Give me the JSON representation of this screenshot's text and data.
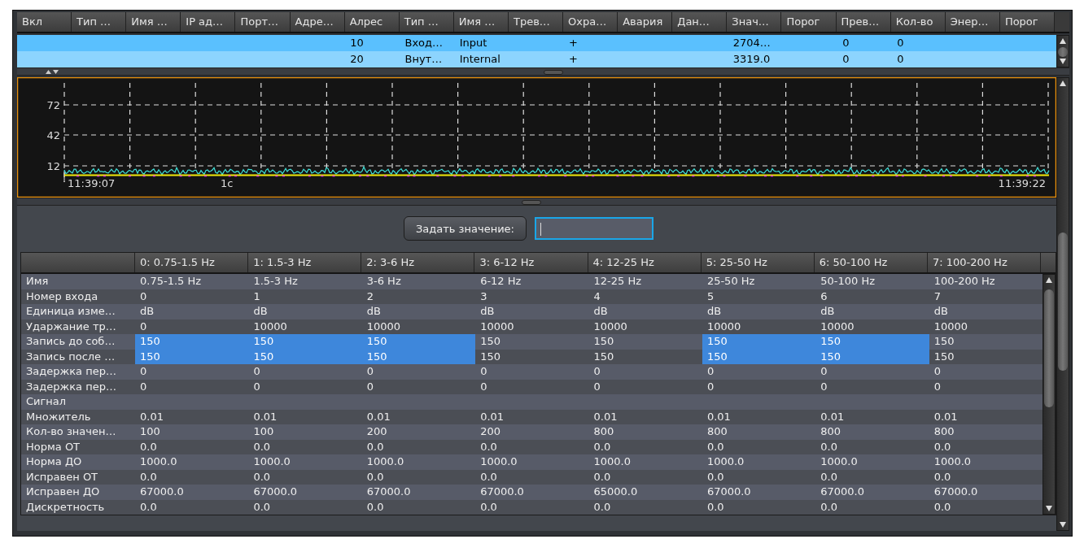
{
  "top_table": {
    "columns": [
      "Вкл",
      "Тип …",
      "Имя …",
      "IP ад…",
      "Порт…",
      "Адре…",
      "Алрес",
      "Тип …",
      "Имя …",
      "Трев…",
      "Охра…",
      "Авария",
      "Дан…",
      "Знач…",
      "Порог",
      "Прев…",
      "Кол-во",
      "Энер…",
      "Порог"
    ],
    "rows": [
      {
        "selected": true,
        "cells": [
          null,
          null,
          null,
          null,
          null,
          null,
          "10",
          "Вход…",
          "Input",
          null,
          "+",
          null,
          null,
          "2704…",
          null,
          "0",
          "0",
          null,
          null
        ]
      },
      {
        "selected": true,
        "cells": [
          null,
          null,
          null,
          null,
          null,
          null,
          "20",
          "Внут…",
          "Internal",
          null,
          "+",
          null,
          null,
          "3319.0",
          null,
          "0",
          "0",
          null,
          null
        ]
      }
    ]
  },
  "chart": {
    "y_ticks": [
      "72",
      "42",
      "12"
    ],
    "time_start": "11:39:07",
    "scale_label": "1c",
    "time_end": "11:39:22"
  },
  "set_value_button": "Задать значение:",
  "value_input": {
    "focused": true
  },
  "parameters": {
    "columns": [
      "0: 0.75-1.5 Hz",
      "1: 1.5-3 Hz",
      "2: 3-6 Hz",
      "3: 6-12 Hz",
      "4: 12-25 Hz",
      "5: 25-50 Hz",
      "6: 50-100 Hz",
      "7: 100-200 Hz"
    ],
    "rows": [
      {
        "label": "Имя",
        "cells": [
          {
            "text": "0.75-1.5 Hz",
            "selected": false
          },
          {
            "text": "1.5-3 Hz",
            "selected": false
          },
          {
            "text": "3-6 Hz",
            "selected": false
          },
          {
            "text": "6-12 Hz",
            "selected": false
          },
          {
            "text": "12-25 Hz",
            "selected": false
          },
          {
            "text": "25-50 Hz",
            "selected": false
          },
          {
            "text": "50-100 Hz",
            "selected": false
          },
          {
            "text": "100-200 Hz",
            "selected": false
          }
        ]
      },
      {
        "label": "Номер входа",
        "cells": [
          {
            "text": "0",
            "selected": false
          },
          {
            "text": "1",
            "selected": false
          },
          {
            "text": "2",
            "selected": false
          },
          {
            "text": "3",
            "selected": false
          },
          {
            "text": "4",
            "selected": false
          },
          {
            "text": "5",
            "selected": false
          },
          {
            "text": "6",
            "selected": false
          },
          {
            "text": "7",
            "selected": false
          }
        ]
      },
      {
        "label": "Единица изме…",
        "cells": [
          {
            "text": "dB",
            "selected": false
          },
          {
            "text": "dB",
            "selected": false
          },
          {
            "text": "dB",
            "selected": false
          },
          {
            "text": "dB",
            "selected": false
          },
          {
            "text": "dB",
            "selected": false
          },
          {
            "text": "dB",
            "selected": false
          },
          {
            "text": "dB",
            "selected": false
          },
          {
            "text": "dB",
            "selected": false
          }
        ]
      },
      {
        "label": "Ударжание тр…",
        "cells": [
          {
            "text": "0",
            "selected": false
          },
          {
            "text": "10000",
            "selected": false
          },
          {
            "text": "10000",
            "selected": false
          },
          {
            "text": "10000",
            "selected": false
          },
          {
            "text": "10000",
            "selected": false
          },
          {
            "text": "10000",
            "selected": false
          },
          {
            "text": "10000",
            "selected": false
          },
          {
            "text": "10000",
            "selected": false
          }
        ]
      },
      {
        "label": "Запись до соб…",
        "cells": [
          {
            "text": "150",
            "selected": true
          },
          {
            "text": "150",
            "selected": true
          },
          {
            "text": "150",
            "selected": true
          },
          {
            "text": "150",
            "selected": false
          },
          {
            "text": "150",
            "selected": false
          },
          {
            "text": "150",
            "selected": true
          },
          {
            "text": "150",
            "selected": true
          },
          {
            "text": "150",
            "selected": false
          }
        ]
      },
      {
        "label": "Запись после …",
        "cells": [
          {
            "text": "150",
            "selected": true
          },
          {
            "text": "150",
            "selected": true
          },
          {
            "text": "150",
            "selected": true
          },
          {
            "text": "150",
            "selected": false
          },
          {
            "text": "150",
            "selected": false
          },
          {
            "text": "150",
            "selected": true
          },
          {
            "text": "150",
            "selected": true
          },
          {
            "text": "150",
            "selected": false
          }
        ]
      },
      {
        "label": "Задержка пер…",
        "cells": [
          {
            "text": "0",
            "selected": false
          },
          {
            "text": "0",
            "selected": false
          },
          {
            "text": "0",
            "selected": false
          },
          {
            "text": "0",
            "selected": false
          },
          {
            "text": "0",
            "selected": false
          },
          {
            "text": "0",
            "selected": false
          },
          {
            "text": "0",
            "selected": false
          },
          {
            "text": "0",
            "selected": false
          }
        ]
      },
      {
        "label": "Задержка пер…",
        "cells": [
          {
            "text": "0",
            "selected": false
          },
          {
            "text": "0",
            "selected": false
          },
          {
            "text": "0",
            "selected": false
          },
          {
            "text": "0",
            "selected": false
          },
          {
            "text": "0",
            "selected": false
          },
          {
            "text": "0",
            "selected": false
          },
          {
            "text": "0",
            "selected": false
          },
          {
            "text": "0",
            "selected": false
          }
        ]
      },
      {
        "label": "Сигнал"
      },
      {
        "label": "Множитель",
        "cells": [
          {
            "text": "0.01",
            "selected": false
          },
          {
            "text": "0.01",
            "selected": false
          },
          {
            "text": "0.01",
            "selected": false
          },
          {
            "text": "0.01",
            "selected": false
          },
          {
            "text": "0.01",
            "selected": false
          },
          {
            "text": "0.01",
            "selected": false
          },
          {
            "text": "0.01",
            "selected": false
          },
          {
            "text": "0.01",
            "selected": false
          }
        ]
      },
      {
        "label": "Кол-во значен…",
        "cells": [
          {
            "text": "100",
            "selected": false
          },
          {
            "text": "100",
            "selected": false
          },
          {
            "text": "200",
            "selected": false
          },
          {
            "text": "200",
            "selected": false
          },
          {
            "text": "800",
            "selected": false
          },
          {
            "text": "800",
            "selected": false
          },
          {
            "text": "800",
            "selected": false
          },
          {
            "text": "800",
            "selected": false
          }
        ]
      },
      {
        "label": "Норма ОТ",
        "cells": [
          {
            "text": "0.0",
            "selected": false
          },
          {
            "text": "0.0",
            "selected": false
          },
          {
            "text": "0.0",
            "selected": false
          },
          {
            "text": "0.0",
            "selected": false
          },
          {
            "text": "0.0",
            "selected": false
          },
          {
            "text": "0.0",
            "selected": false
          },
          {
            "text": "0.0",
            "selected": false
          },
          {
            "text": "0.0",
            "selected": false
          }
        ]
      },
      {
        "label": "Норма ДО",
        "cells": [
          {
            "text": "1000.0",
            "selected": false
          },
          {
            "text": "1000.0",
            "selected": false
          },
          {
            "text": "1000.0",
            "selected": false
          },
          {
            "text": "1000.0",
            "selected": false
          },
          {
            "text": "1000.0",
            "selected": false
          },
          {
            "text": "1000.0",
            "selected": false
          },
          {
            "text": "1000.0",
            "selected": false
          },
          {
            "text": "1000.0",
            "selected": false
          }
        ]
      },
      {
        "label": "Исправен ОТ",
        "cells": [
          {
            "text": "0.0",
            "selected": false
          },
          {
            "text": "0.0",
            "selected": false
          },
          {
            "text": "0.0",
            "selected": false
          },
          {
            "text": "0.0",
            "selected": false
          },
          {
            "text": "0.0",
            "selected": false
          },
          {
            "text": "0.0",
            "selected": false
          },
          {
            "text": "0.0",
            "selected": false
          },
          {
            "text": "0.0",
            "selected": false
          }
        ]
      },
      {
        "label": "Исправен ДО",
        "cells": [
          {
            "text": "67000.0",
            "selected": false
          },
          {
            "text": "67000.0",
            "selected": false
          },
          {
            "text": "67000.0",
            "selected": false
          },
          {
            "text": "67000.0",
            "selected": false
          },
          {
            "text": "65000.0",
            "selected": false
          },
          {
            "text": "67000.0",
            "selected": false
          },
          {
            "text": "67000.0",
            "selected": false
          },
          {
            "text": "67000.0",
            "selected": false
          }
        ]
      },
      {
        "label": "Дискретность",
        "cells": [
          {
            "text": "0.0",
            "selected": false
          },
          {
            "text": "0.0",
            "selected": false
          },
          {
            "text": "0.0",
            "selected": false
          },
          {
            "text": "0.0",
            "selected": false
          },
          {
            "text": "0.0",
            "selected": false
          },
          {
            "text": "0.0",
            "selected": false
          },
          {
            "text": "0.0",
            "selected": false
          },
          {
            "text": "0.0",
            "selected": false
          }
        ]
      }
    ]
  }
}
